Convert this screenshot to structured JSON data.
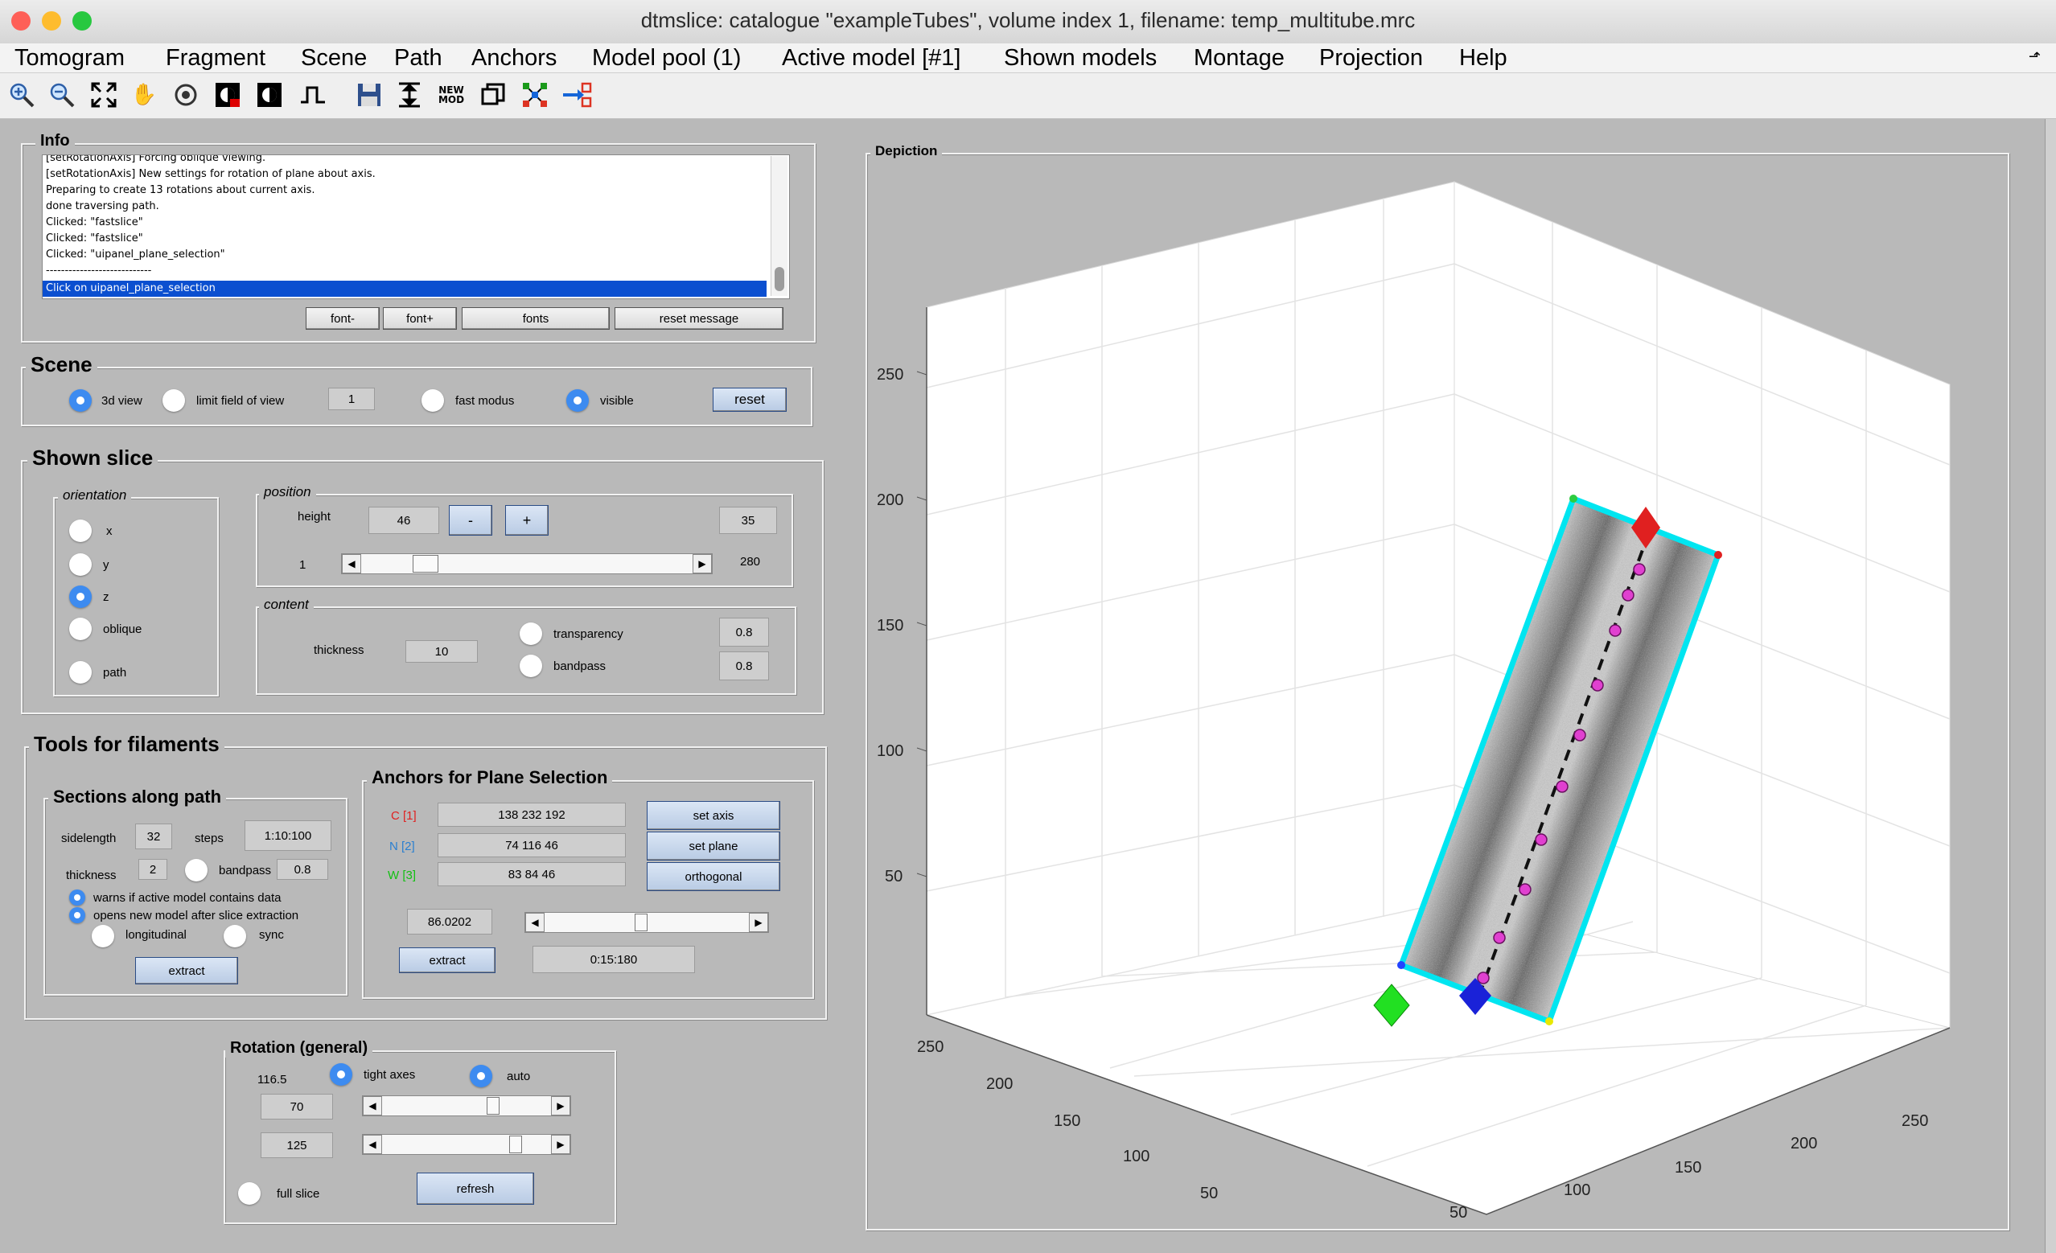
{
  "window": {
    "title": "dtmslice: catalogue \"exampleTubes\", volume index 1, filename: temp_multitube.mrc",
    "traffic_colors": [
      "#fe5f57",
      "#febc2e",
      "#28c840"
    ]
  },
  "menu": [
    "Tomogram",
    "Fragment",
    "Scene",
    "Path",
    "Anchors",
    "Model pool (1)",
    "Active model [#1]",
    "Shown models",
    "Montage",
    "Projection",
    "Help"
  ],
  "toolbar": {
    "icons": [
      "zoom-in-icon",
      "zoom-out-icon",
      "fit-icon",
      "pan-hand-icon",
      "rotate-icon",
      "contrast-icon",
      "contrast-alt-icon",
      "step-icon",
      "save-icon",
      "range-icon"
    ],
    "new_mod_line1": "NEW",
    "new_mod_line2": "MOD"
  },
  "info": {
    "title": "Info",
    "lines": [
      "[setRotationAxis] Forcing oblique viewing.",
      "[setRotationAxis] New settings for rotation of plane about axis.",
      "Preparing to create 13 rotations about current axis.",
      "done traversing path.",
      "Clicked: \"fastslice\"",
      "Clicked: \"fastslice\"",
      "Clicked: \"uipanel_plane_selection\"",
      "----------------------------"
    ],
    "selected_line": "Click on uipanel_plane_selection",
    "buttons": {
      "font_minus": "font-",
      "font_plus": "font+",
      "fonts": "fonts",
      "reset_message": "reset message"
    }
  },
  "scene": {
    "title": "Scene",
    "view3d": "3d view",
    "limit_fov": "limit field of view",
    "fov_value": "1",
    "fast_modus": "fast modus",
    "visible": "visible",
    "reset": "reset"
  },
  "shown_slice": {
    "title": "Shown slice",
    "orientation": {
      "title": "orientation",
      "x": "x",
      "y": "y",
      "z": "z",
      "oblique": "oblique",
      "path": "path"
    },
    "position": {
      "title": "position",
      "height_label": "height",
      "height_value": "46",
      "minus": "-",
      "plus": "+",
      "max_field": "35",
      "min": "1",
      "max": "280"
    },
    "content": {
      "title": "content",
      "thickness_label": "thickness",
      "thickness_value": "10",
      "transparency": "transparency",
      "transparency_value": "0.8",
      "bandpass": "bandpass",
      "bandpass_value": "0.8"
    }
  },
  "tools": {
    "title": "Tools for filaments",
    "sections": {
      "title": "Sections along path",
      "sidelength_label": "sidelength",
      "sidelength_value": "32",
      "steps_label": "steps",
      "steps_value": "1:10:100",
      "thickness_label": "thickness",
      "thickness_value": "2",
      "bandpass_label": "bandpass",
      "bandpass_value": "0.8",
      "warns": "warns if active model contains data",
      "opens": "opens new model after slice extraction",
      "longitudinal": "longitudinal",
      "sync": "sync",
      "extract": "extract"
    },
    "anchors": {
      "title": "Anchors for Plane Selection",
      "c_label": "C [1]",
      "c_value": "138 232 192",
      "c_color": "#e02020",
      "n_label": "N [2]",
      "n_value": "74 116 46",
      "n_color": "#2a7fd0",
      "w_label": "W [3]",
      "w_value": "83 84 46",
      "w_color": "#12c012",
      "set_axis": "set axis",
      "set_plane": "set plane",
      "orthogonal": "orthogonal",
      "angle_value": "86.0202",
      "extract": "extract",
      "range_value": "0:15:180"
    }
  },
  "rotation": {
    "title": "Rotation (general)",
    "value_116": "116.5",
    "tight_axes": "tight axes",
    "auto": "auto",
    "v1": "70",
    "v2": "125",
    "full_slice": "full slice",
    "refresh": "refresh"
  },
  "depiction": {
    "title": "Depiction",
    "z_ticks": [
      "250",
      "200",
      "150",
      "100",
      "50"
    ],
    "left_ticks": [
      "250",
      "200",
      "150",
      "100",
      "50"
    ],
    "right_ticks": [
      "250",
      "200",
      "150",
      "100",
      "50"
    ],
    "slice_border_color": "#00e5f0",
    "path_point_color": "#e040d0"
  }
}
